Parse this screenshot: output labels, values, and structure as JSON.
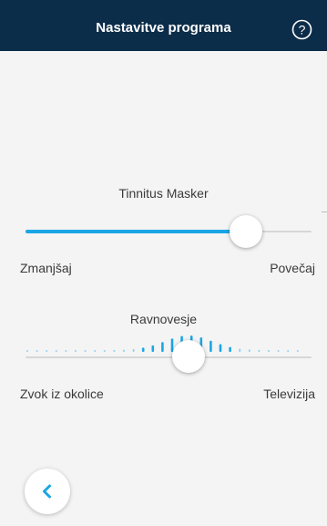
{
  "header": {
    "title": "Nastavitve programa",
    "help_icon": "help-circle-icon"
  },
  "tinnitus": {
    "title": "Tinnitus Masker",
    "min_label": "Zmanjšaj",
    "max_label": "Povečaj",
    "value_fraction": 0.77
  },
  "balance": {
    "title": "Ravnovesje",
    "left_label": "Zvok iz okolice",
    "right_label": "Televizija",
    "value_fraction": 0.57
  },
  "footer": {
    "back_icon": "chevron-left-icon"
  },
  "colors": {
    "header_bg": "#0c2d4a",
    "accent": "#1aa6e6",
    "background": "#f4f4f4"
  }
}
